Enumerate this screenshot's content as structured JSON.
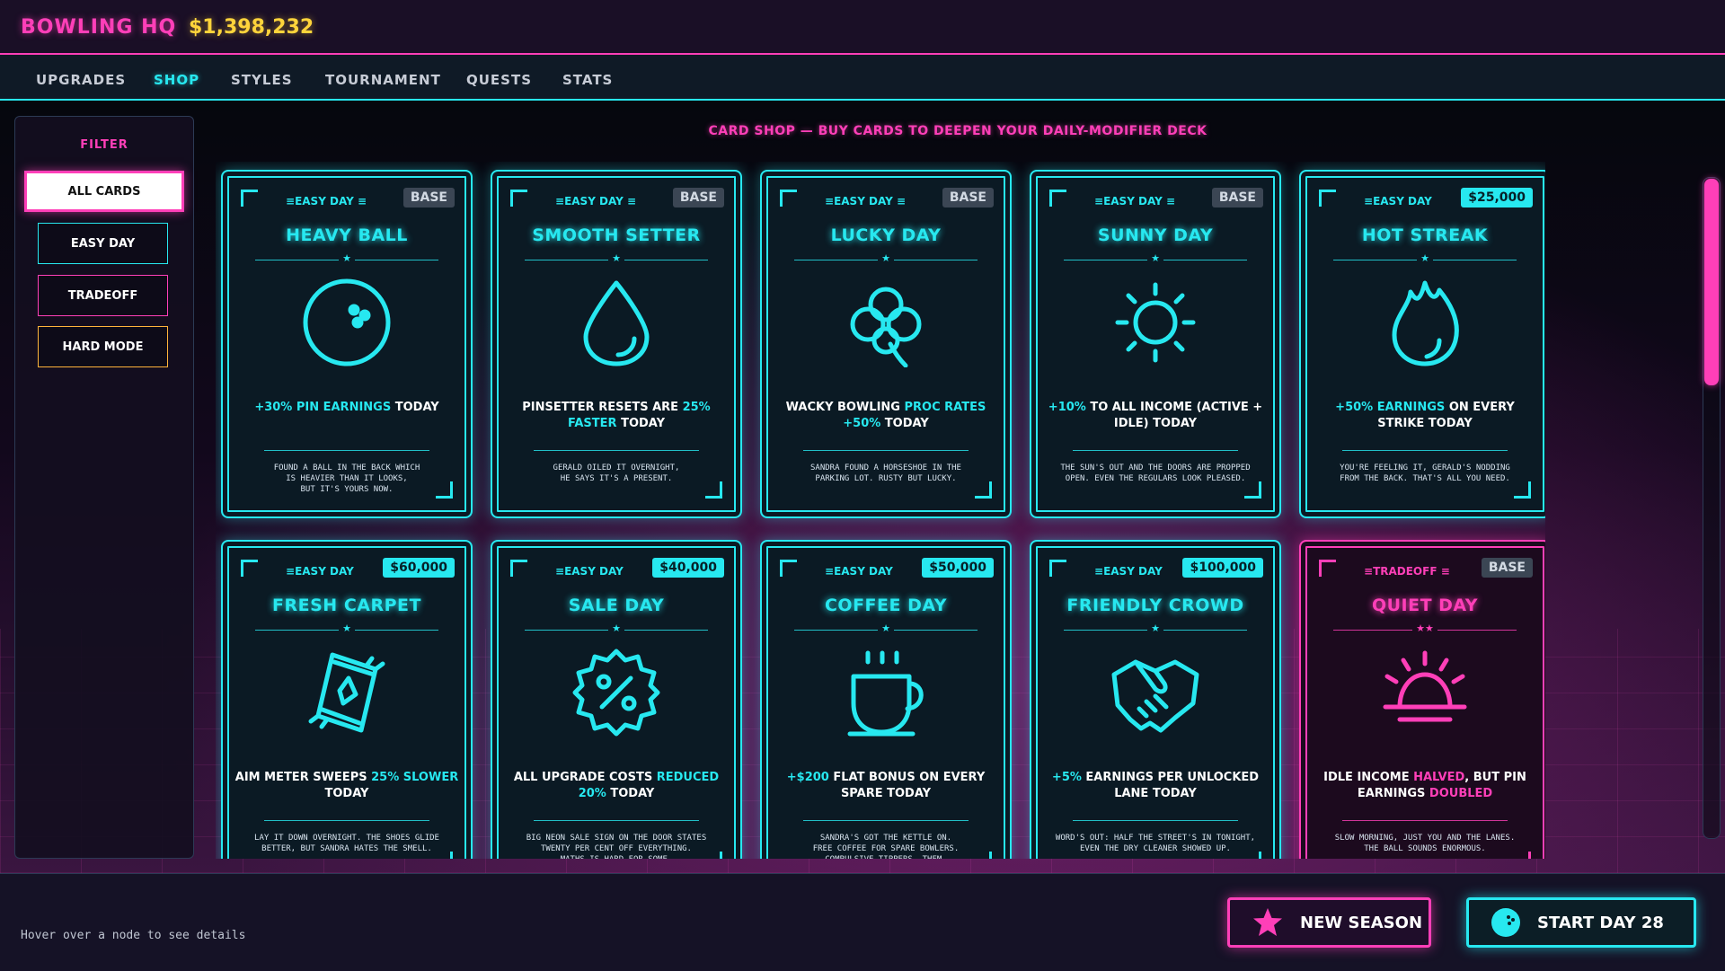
{
  "header": {
    "title": "BOWLING HQ",
    "money": "$1,398,232"
  },
  "tabs": [
    "UPGRADES",
    "SHOP",
    "STYLES",
    "TOURNAMENT",
    "QUESTS",
    "STATS"
  ],
  "filter": {
    "title": "FILTER",
    "options": [
      "ALL CARDS",
      "EASY DAY",
      "TRADEOFF",
      "HARD MODE"
    ],
    "selected": "ALL CARDS"
  },
  "shop": {
    "heading": "CARD SHOP — BUY CARDS TO DEEPEN YOUR DAILY-MODIFIER DECK"
  },
  "cards": [
    {
      "category": "EASY DAY",
      "badge": "BASE",
      "title": "HEAVY BALL",
      "stars": "★",
      "icon": "bowling-ball-icon",
      "effect": [
        [
          "+30% PIN EARNINGS",
          true
        ],
        [
          " TODAY",
          false
        ]
      ],
      "flavor": "FOUND A BALL IN THE BACK WHICH\nIS HEAVIER THAN IT LOOKS,\nBUT IT'S YOURS NOW."
    },
    {
      "category": "EASY DAY",
      "badge": "BASE",
      "title": "SMOOTH SETTER",
      "stars": "★",
      "icon": "oil-drop-icon",
      "effect": [
        [
          "PINSETTER RESETS ARE ",
          false
        ],
        [
          "25% FASTER",
          true
        ],
        [
          " TODAY",
          false
        ]
      ],
      "flavor": "GERALD OILED IT OVERNIGHT,\nHE SAYS IT'S A PRESENT."
    },
    {
      "category": "EASY DAY",
      "badge": "BASE",
      "title": "LUCKY DAY",
      "stars": "★",
      "icon": "clover-icon",
      "effect": [
        [
          "WACKY BOWLING ",
          false
        ],
        [
          "PROC RATES +50%",
          true
        ],
        [
          " TODAY",
          false
        ]
      ],
      "flavor": "SANDRA FOUND A HORSESHOE IN THE\nPARKING LOT. RUSTY BUT LUCKY."
    },
    {
      "category": "EASY DAY",
      "badge": "BASE",
      "title": "SUNNY DAY",
      "stars": "★",
      "icon": "sun-icon",
      "effect": [
        [
          "+10%",
          true
        ],
        [
          " TO ALL INCOME (ACTIVE + IDLE) TODAY",
          false
        ]
      ],
      "flavor": "THE SUN'S OUT AND THE DOORS ARE PROPPED\nOPEN.  EVEN THE REGULARS LOOK PLEASED."
    },
    {
      "category": "EASY DAY",
      "badge": "$25,000",
      "title": "HOT STREAK",
      "stars": "★",
      "icon": "flame-icon",
      "effect": [
        [
          "+50% EARNINGS",
          true
        ],
        [
          " ON EVERY STRIKE TODAY",
          false
        ]
      ],
      "flavor": "YOU'RE FEELING IT, GERALD'S NODDING\nFROM THE BACK. THAT'S ALL YOU NEED."
    },
    {
      "category": "EASY DAY",
      "badge": "$60,000",
      "title": "FRESH CARPET",
      "stars": "★",
      "icon": "carpet-icon",
      "effect": [
        [
          "AIM METER SWEEPS ",
          false
        ],
        [
          "25% SLOWER",
          true
        ],
        [
          " TODAY",
          false
        ]
      ],
      "flavor": "LAY IT DOWN OVERNIGHT. THE SHOES GLIDE\nBETTER, BUT SANDRA HATES THE SMELL."
    },
    {
      "category": "EASY DAY",
      "badge": "$40,000",
      "title": "SALE DAY",
      "stars": "★",
      "icon": "discount-badge-icon",
      "effect": [
        [
          "ALL UPGRADE COSTS ",
          false
        ],
        [
          "REDUCED 20%",
          true
        ],
        [
          " TODAY",
          false
        ]
      ],
      "flavor": "BIG NEON SALE SIGN ON THE DOOR STATES\nTWENTY PER CENT OFF EVERYTHING.\nMATHS IS HARD FOR SOME."
    },
    {
      "category": "EASY DAY",
      "badge": "$50,000",
      "title": "COFFEE DAY",
      "stars": "★",
      "icon": "coffee-cup-icon",
      "effect": [
        [
          "+$200",
          true
        ],
        [
          " FLAT BONUS ON EVERY SPARE TODAY",
          false
        ]
      ],
      "flavor": "SANDRA'S GOT THE KETTLE ON.\nFREE COFFEE FOR SPARE BOWLERS.\nCOMPULSIVE TIPPERS, THEM."
    },
    {
      "category": "EASY DAY",
      "badge": "$100,000",
      "title": "FRIENDLY CROWD",
      "stars": "★",
      "icon": "handshake-icon",
      "effect": [
        [
          "+5%",
          true
        ],
        [
          " EARNINGS PER UNLOCKED LANE TODAY",
          false
        ]
      ],
      "flavor": "WORD'S OUT: HALF THE STREET'S IN TONIGHT,\nEVEN THE DRY CLEANER SHOWED UP."
    },
    {
      "category": "TRADEOFF",
      "badge": "BASE",
      "title": "QUIET DAY",
      "stars": "★★",
      "icon": "sunrise-icon",
      "effect": [
        [
          "IDLE INCOME ",
          false
        ],
        [
          "HALVED",
          true
        ],
        [
          ", BUT PIN EARNINGS ",
          false
        ],
        [
          "DOUBLED",
          true
        ]
      ],
      "flavor": "SLOW MORNING, JUST YOU AND THE LANES.\nTHE BALL SOUNDS ENORMOUS."
    }
  ],
  "footer": {
    "hint": "Hover over a node to see details",
    "new_season": "NEW SEASON",
    "start_day": "START DAY 28"
  },
  "colors": {
    "cyan": "#27e8f0",
    "pink": "#ff3fb8",
    "gold": "#ffd43b",
    "orange": "#ffb43b"
  }
}
